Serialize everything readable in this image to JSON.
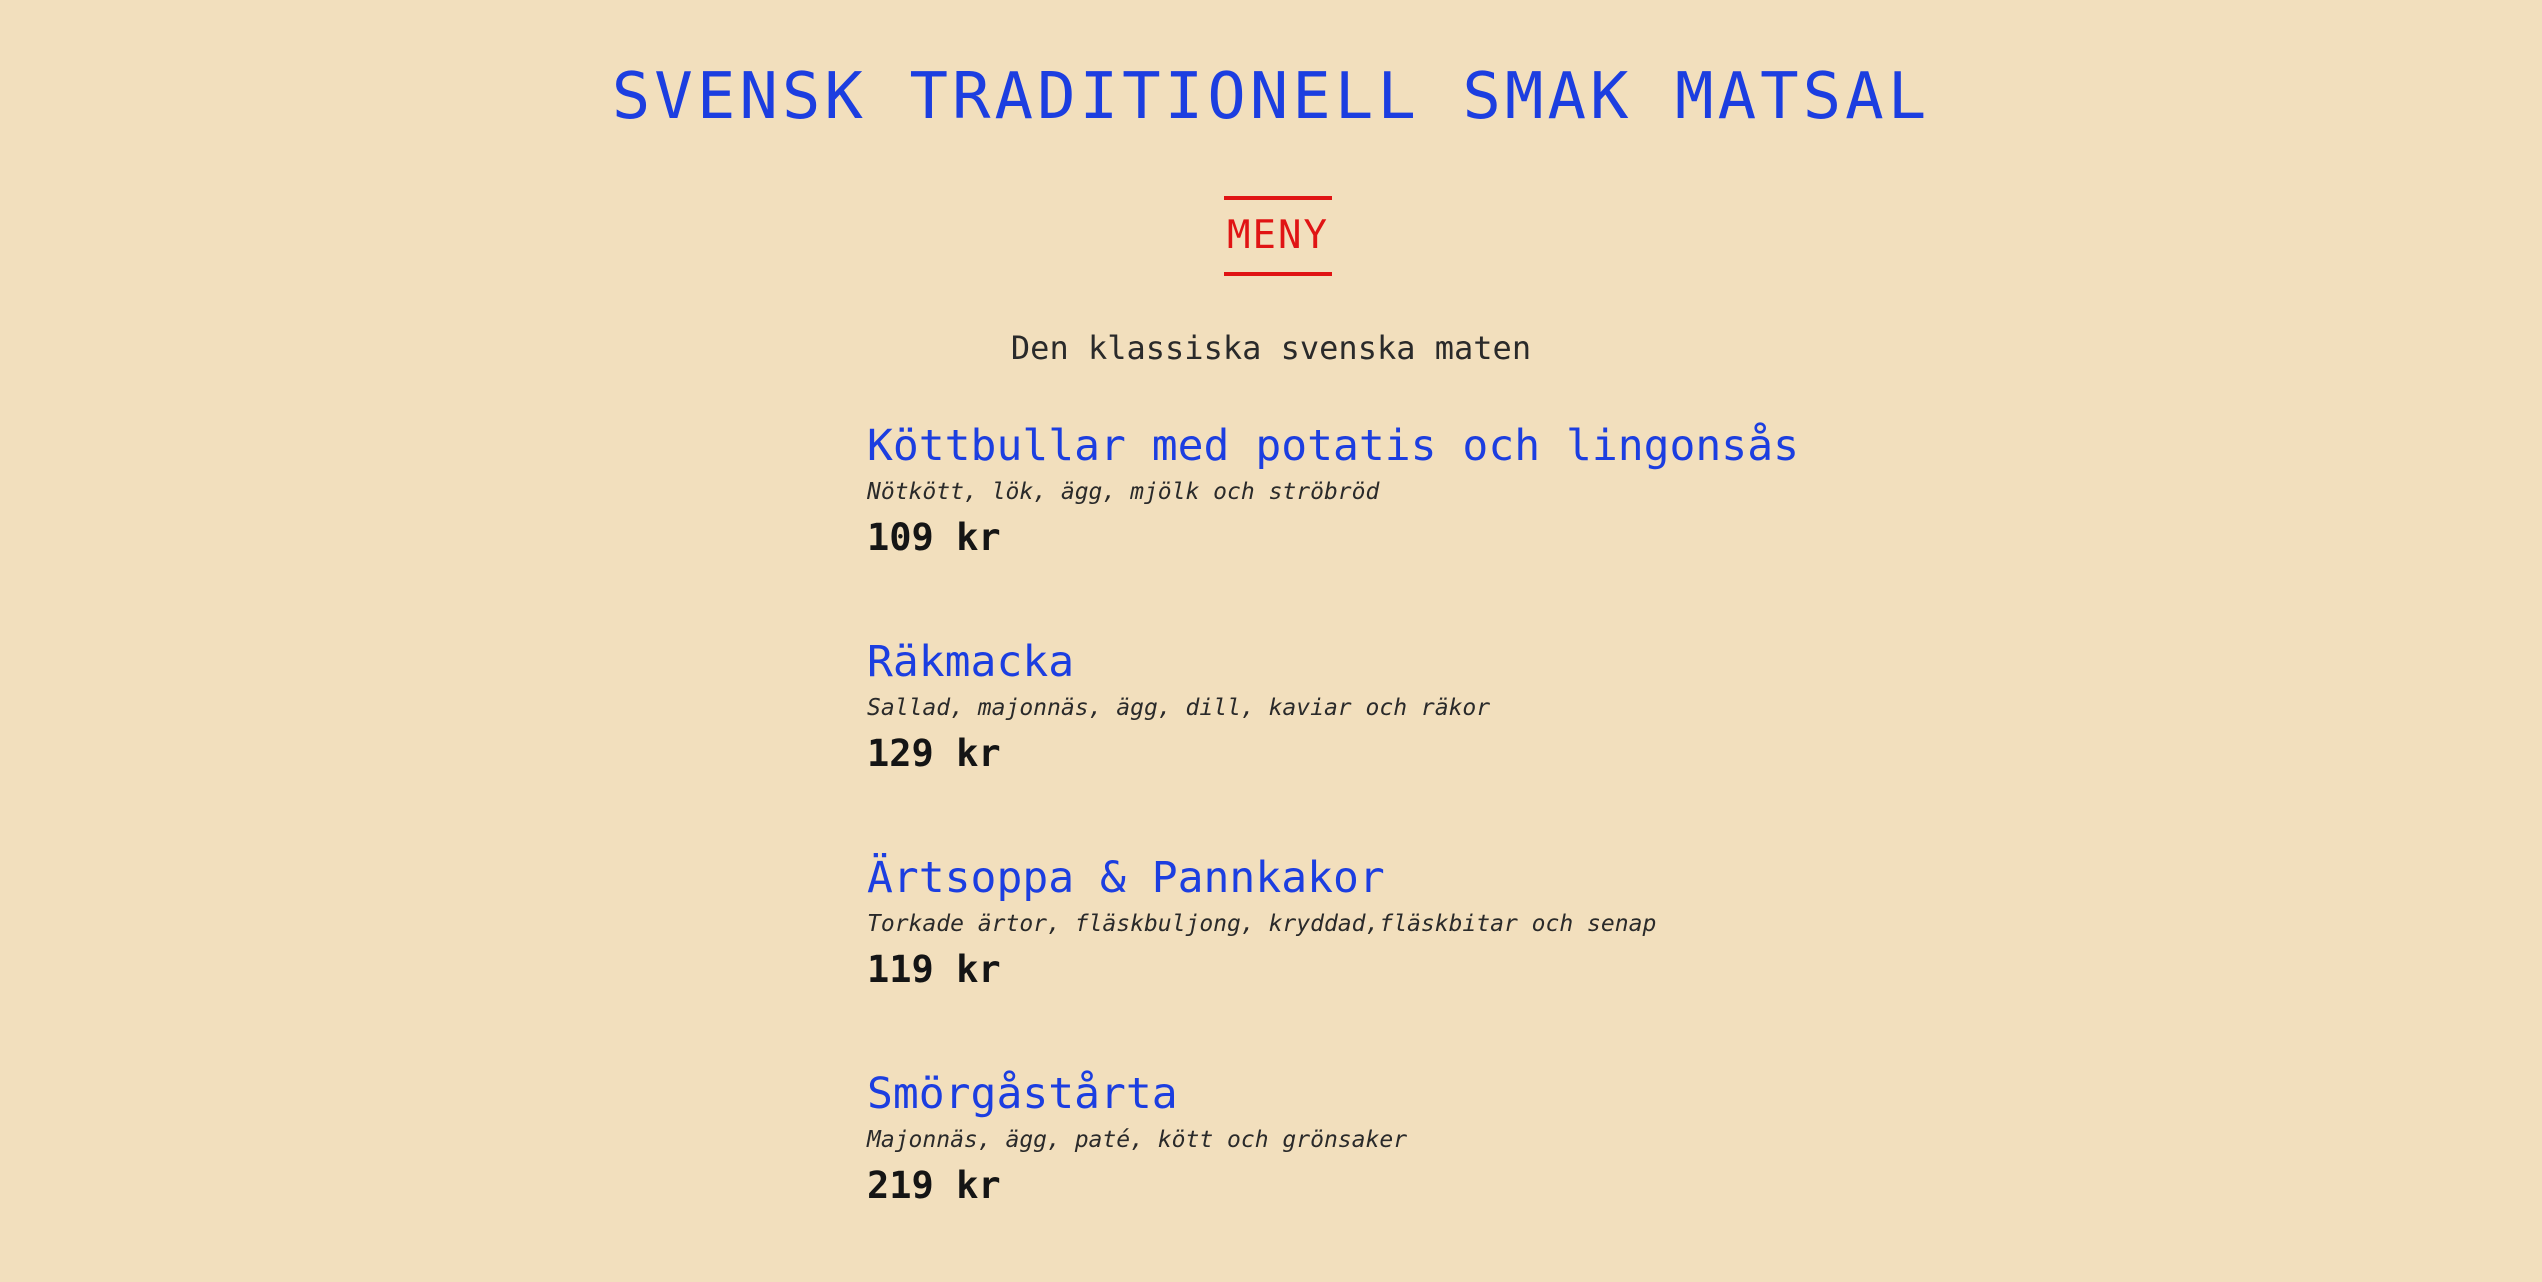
{
  "header": {
    "title": "SVENSK TRADITIONELL SMAK MATSAL",
    "menu_label": "MENY",
    "subtitle": "Den klassiska svenska maten"
  },
  "colors": {
    "background": "#f2dfbd",
    "title": "#1c3ee0",
    "accent": "#e01414",
    "text": "#2a2a2a"
  },
  "menu": {
    "items": [
      {
        "name": "Köttbullar med potatis och lingonsås",
        "ingredients": "Nötkött, lök, ägg, mjölk och ströbröd",
        "price": "109 kr"
      },
      {
        "name": "Räkmacka",
        "ingredients": "Sallad, majonnäs, ägg, dill, kaviar och räkor",
        "price": "129 kr"
      },
      {
        "name": "Ärtsoppa & Pannkakor",
        "ingredients": "Torkade ärtor, fläskbuljong, kryddad,fläskbitar och senap",
        "price": "119 kr"
      },
      {
        "name": "Smörgåstårta",
        "ingredients": "Majonnäs, ägg, paté, kött och grönsaker",
        "price": "219 kr"
      }
    ]
  }
}
